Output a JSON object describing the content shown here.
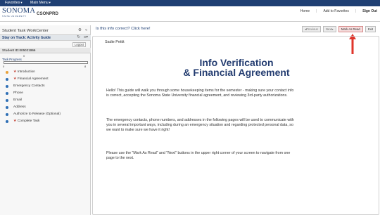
{
  "favorites_bar": {
    "favorites": "Favorites",
    "main_menu": "Main Menu",
    "caret": "▾"
  },
  "header": {
    "logo_word": "SONOMA",
    "logo_sub": "STATE UNIVERSITY",
    "database": "CSONPRD",
    "links": [
      "Home",
      "Add to Favorites",
      "Sign Out"
    ]
  },
  "left_panel": {
    "title": "Student Task WorkCenter",
    "track_label": "Stay on Track: Activity Guide",
    "logout": "Logout",
    "student_id": "Student ID:005021866",
    "progress_label": "Task Progress",
    "progress_value": "0",
    "progress_min": "0",
    "progress_max": "8",
    "progress_fraction": 0,
    "required_marker": "★",
    "steps": [
      {
        "label": "Introduction",
        "required": true,
        "status": "active"
      },
      {
        "label": "Financial Agreement",
        "required": true,
        "status": "todo"
      },
      {
        "label": "Emergency Contacts",
        "required": false,
        "status": "todo"
      },
      {
        "label": "Phone",
        "required": false,
        "status": "todo"
      },
      {
        "label": "Email",
        "required": false,
        "status": "todo"
      },
      {
        "label": "Address",
        "required": false,
        "status": "todo"
      },
      {
        "label": "Authorize to Release (Optional)",
        "required": false,
        "status": "todo"
      },
      {
        "label": "Complete Task",
        "required": true,
        "status": "todo"
      }
    ]
  },
  "content": {
    "correct_link": "Is this info correct? Click here!",
    "buttons": {
      "previous": "◂Previous",
      "next": "Next▸",
      "mark_as_read": "Mark As Read",
      "exit": "Exit"
    },
    "greeting": "Sadie Pettit",
    "heading_line1": "Info Verification",
    "heading_line2": "& Financial Agreement",
    "paragraphs": [
      "Hello! This guide will walk you through some housekeeping items for the semester - making sure your contact info is correct, accepting the Sonoma State University financial agreement, and reviewing 3rd-party authorizations.",
      "The emergency contacts, phone numbers, and addresses in the following pages will be used to communicate with you in several important ways, including during an emergency situation and regarding protected personal data, so we want to make sure we have it right!",
      "Please use the \"Mark As Read\" and \"Next\" buttons in the upper right corner of your screen to navigate from one page to the next."
    ]
  },
  "colors": {
    "brand_navy": "#1f3f73",
    "heading_blue": "#233c70",
    "annotation_red": "#e0352b",
    "active_step": "#e8a13a",
    "step_dot": "#2e6fb5"
  }
}
